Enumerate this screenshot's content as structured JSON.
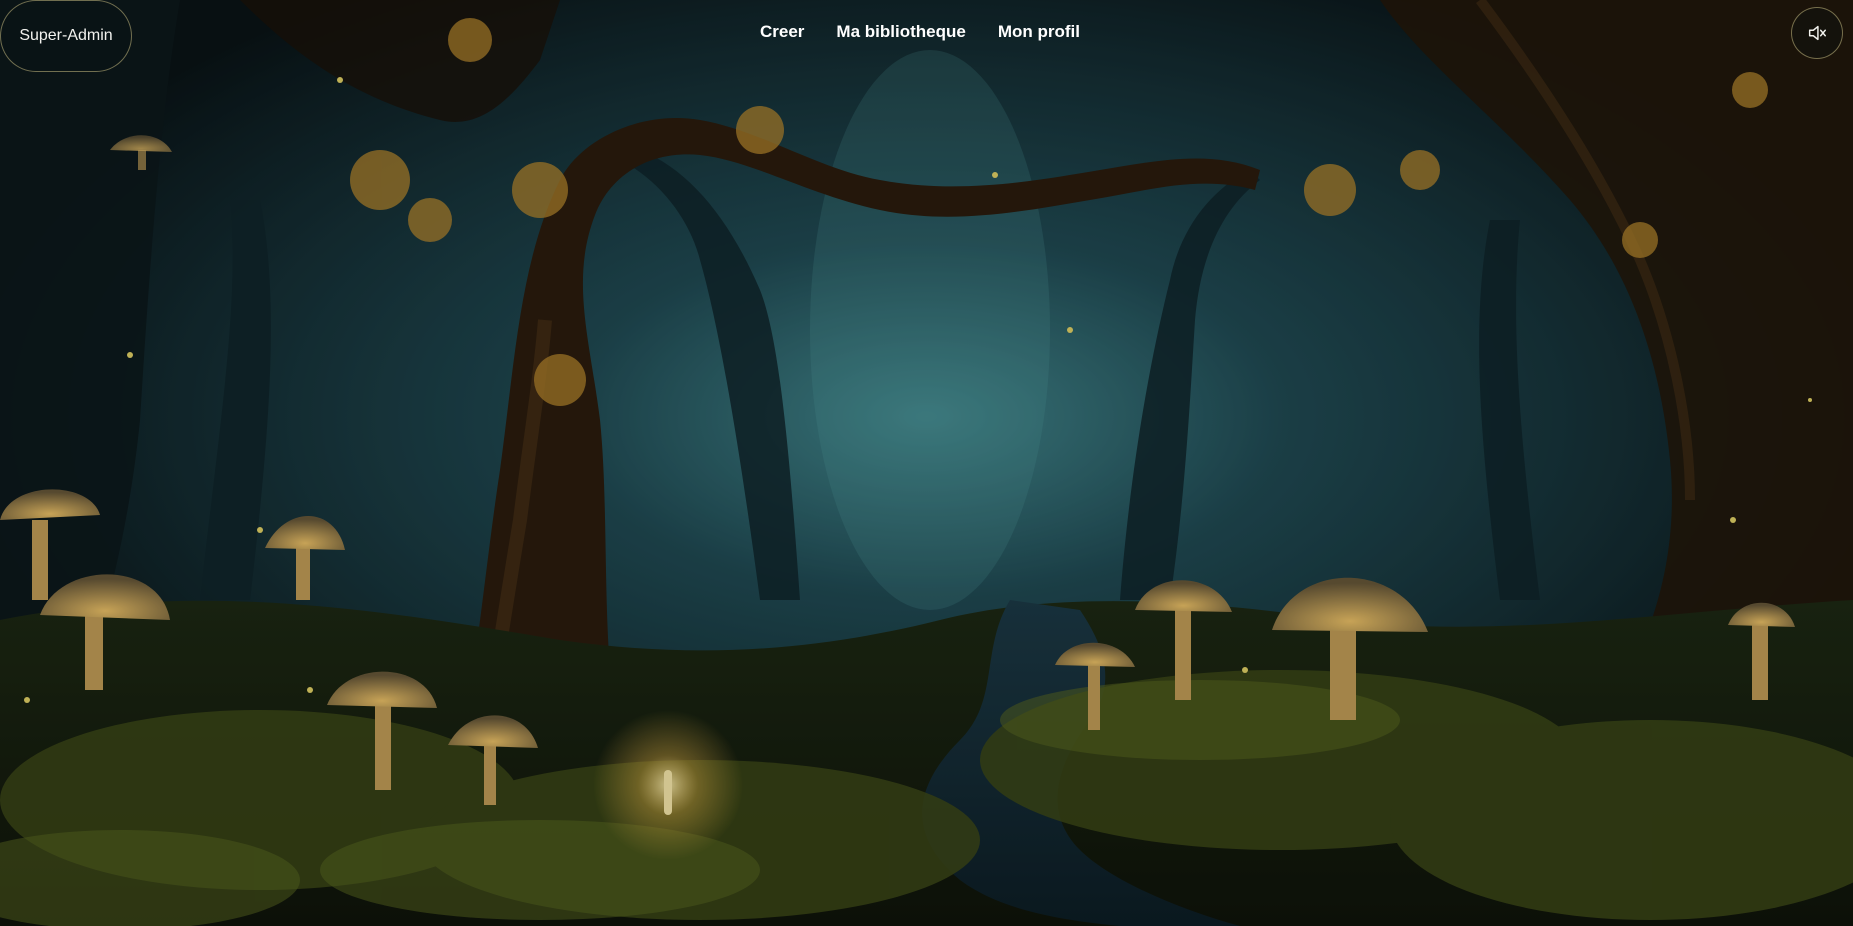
{
  "header": {
    "user_label": "Super-Admin",
    "nav": [
      {
        "label": "Creer"
      },
      {
        "label": "Ma bibliotheque"
      },
      {
        "label": "Mon profil"
      }
    ],
    "sound_icon": "volume-muted-icon"
  },
  "background": {
    "description_icon": "enchanted-forest-illustration",
    "colors": {
      "sky": "#1d4a55",
      "mist": "#3f8a90",
      "foliage": "#3a3a12",
      "glow": "#f0c25a",
      "trunk": "#3a2612"
    }
  }
}
